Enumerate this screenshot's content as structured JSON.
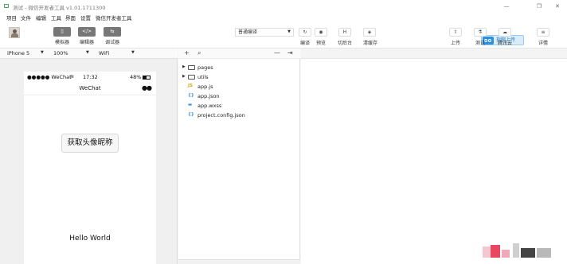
{
  "window": {
    "title": "测试 - 微信开发者工具 v1.01.1711300",
    "controls": [
      "—",
      "❐",
      "✕"
    ]
  },
  "menu": [
    "项目",
    "文件",
    "编辑",
    "工具",
    "界面",
    "设置",
    "微信开发者工具"
  ],
  "toolbar": {
    "modes": [
      {
        "label": "模拟器",
        "glyph": "▯"
      },
      {
        "label": "编辑器",
        "glyph": "</>"
      },
      {
        "label": "调试器",
        "glyph": "⇆"
      }
    ],
    "compile_mode": "普通编译",
    "actions": [
      {
        "label": "编译",
        "glyph": "↻"
      },
      {
        "label": "预览",
        "glyph": "◉"
      },
      {
        "label": "切后台",
        "glyph": "H"
      },
      {
        "label": "清缓存",
        "glyph": "◈"
      }
    ],
    "right_actions": [
      {
        "label": "上传",
        "glyph": "⇧"
      },
      {
        "label": "测试",
        "glyph": "⚗"
      },
      {
        "label": "腾讯云",
        "glyph": "☁"
      },
      {
        "label": "详情",
        "glyph": "≡"
      }
    ],
    "upload_hint": "指腕上传"
  },
  "simulator": {
    "device": "iPhone 5",
    "zoom": "100%",
    "network": "WiFi",
    "status_carrier": "●●●●● WeChat",
    "status_time": "17:32",
    "status_battery": "48%",
    "nav_title": "WeChat",
    "nav_menu": "●●",
    "button_label": "获取头像昵称",
    "hello_text": "Hello World"
  },
  "explorer": {
    "tools": [
      "+",
      "⌕",
      "—",
      "⇥"
    ],
    "items": [
      {
        "name": "pages",
        "type": "folder"
      },
      {
        "name": "utils",
        "type": "folder"
      },
      {
        "name": "app.js",
        "type": "js",
        "badge": "JS",
        "color": "#d8a400"
      },
      {
        "name": "app.json",
        "type": "json",
        "badge": "{}",
        "color": "#2f8fde"
      },
      {
        "name": "app.wxss",
        "type": "wxss",
        "badge": "▬",
        "color": "#2f8fde"
      },
      {
        "name": "project.config.json",
        "type": "json",
        "badge": "{}",
        "color": "#2f8fde"
      }
    ]
  }
}
